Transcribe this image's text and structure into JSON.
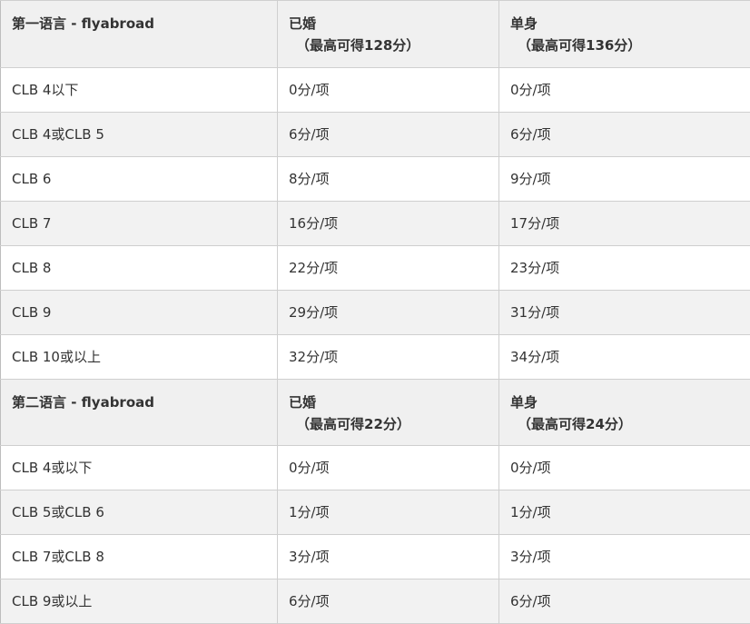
{
  "table": {
    "sections": [
      {
        "header": {
          "col1": "第一语言 - flyabroad",
          "col2_title": "已婚",
          "col2_sub": "（最高可得128分）",
          "col3_title": "单身",
          "col3_sub": "（最高可得136分）"
        },
        "rows": [
          {
            "level": "CLB 4以下",
            "married": "0分/项",
            "single": "0分/项"
          },
          {
            "level": "CLB 4或CLB 5",
            "married": "6分/项",
            "single": "6分/项"
          },
          {
            "level": "CLB 6",
            "married": "8分/项",
            "single": "9分/项"
          },
          {
            "level": "CLB 7",
            "married": "16分/项",
            "single": "17分/项"
          },
          {
            "level": "CLB 8",
            "married": "22分/项",
            "single": "23分/项"
          },
          {
            "level": "CLB 9",
            "married": "29分/项",
            "single": "31分/项"
          },
          {
            "level": "CLB 10或以上",
            "married": "32分/项",
            "single": "34分/项"
          }
        ]
      },
      {
        "header": {
          "col1": "第二语言 - flyabroad",
          "col2_title": "已婚",
          "col2_sub": "（最高可得22分）",
          "col3_title": "单身",
          "col3_sub": "（最高可得24分）"
        },
        "rows": [
          {
            "level": "CLB 4或以下",
            "married": "0分/项",
            "single": "0分/项"
          },
          {
            "level": "CLB 5或CLB 6",
            "married": "1分/项",
            "single": "1分/项"
          },
          {
            "level": "CLB 7或CLB 8",
            "married": "3分/项",
            "single": "3分/项"
          },
          {
            "level": "CLB 9或以上",
            "married": "6分/项",
            "single": "6分/项"
          }
        ]
      }
    ]
  }
}
